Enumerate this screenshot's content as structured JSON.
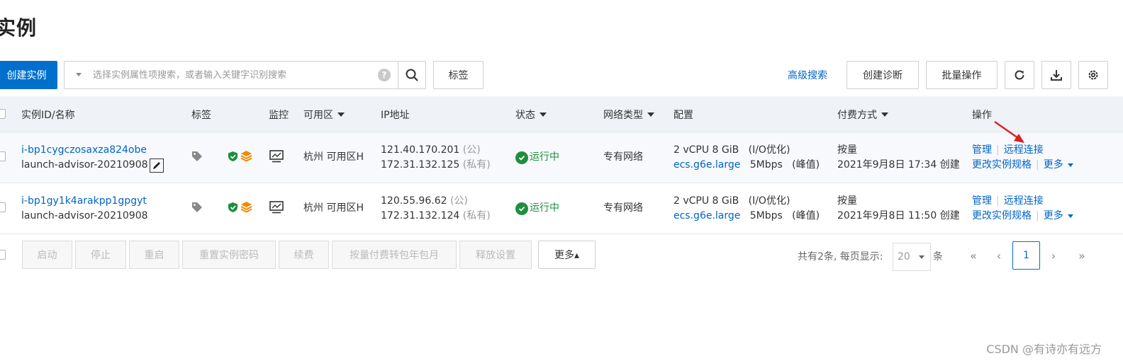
{
  "page": {
    "title": "实例"
  },
  "toolbar": {
    "create_label": "创建实例",
    "search_placeholder": "选择实例属性项搜索，或者输入关键字识别搜索",
    "tag_label": "标签",
    "advanced_search": "高级搜索",
    "diagnose_label": "创建诊断",
    "batch_label": "批量操作",
    "icons": [
      "refresh-icon",
      "download-icon",
      "settings-icon"
    ]
  },
  "table": {
    "headers": {
      "id": "实例ID/名称",
      "tags": "标签",
      "monitor": "监控",
      "zone": "可用区",
      "ip": "IP地址",
      "status": "状态",
      "network": "网络类型",
      "config": "配置",
      "billing": "付费方式",
      "actions": "操作"
    },
    "rows": [
      {
        "id": "i-bp1cygczosaxza824obe",
        "name": "launch-advisor-20210908",
        "zone": "杭州 可用区H",
        "ip_public": "121.40.170.201",
        "ip_public_tag": "(公)",
        "ip_private": "172.31.132.125",
        "ip_private_tag": "(私有)",
        "status": "运行中",
        "network": "专有网络",
        "config_cpu": "2 vCPU 8 GiB",
        "config_io": "(I/O优化)",
        "config_spec": "ecs.g6e.large",
        "config_bw": "5Mbps",
        "config_bw_tag": "(峰值)",
        "billing_type": "按量",
        "created": "2021年9月8日 17:34 创建",
        "action_manage": "管理",
        "action_remote": "远程连接",
        "action_change": "更改实例规格",
        "action_more": "更多"
      },
      {
        "id": "i-bp1gy1k4arakpp1gpgyt",
        "name": "launch-advisor-20210908",
        "zone": "杭州 可用区H",
        "ip_public": "120.55.96.62",
        "ip_public_tag": "(公)",
        "ip_private": "172.31.132.124",
        "ip_private_tag": "(私有)",
        "status": "运行中",
        "network": "专有网络",
        "config_cpu": "2 vCPU 8 GiB",
        "config_io": "(I/O优化)",
        "config_spec": "ecs.g6e.large",
        "config_bw": "5Mbps",
        "config_bw_tag": "(峰值)",
        "billing_type": "按量",
        "created": "2021年9月8日 11:50 创建",
        "action_manage": "管理",
        "action_remote": "远程连接",
        "action_change": "更改实例规格",
        "action_more": "更多"
      }
    ]
  },
  "bottom_bar": {
    "buttons": [
      "启动",
      "停止",
      "重启",
      "重置实例密码",
      "续费",
      "按量付费转包年包月",
      "释放设置"
    ],
    "more_label": "更多▴",
    "pager": {
      "summary": "共有2条, 每页显示:",
      "page_size": "20",
      "unit": "条",
      "current_page": "1",
      "first": "«",
      "prev": "‹",
      "next": "›",
      "last": "»"
    }
  },
  "colors": {
    "primary": "#0070cc",
    "link": "#0064c8",
    "running": "#1e8e3e",
    "header_bg": "#eff3f8",
    "annotation_arrow": "#e02020"
  },
  "watermark": "CSDN @有诗亦有远方"
}
